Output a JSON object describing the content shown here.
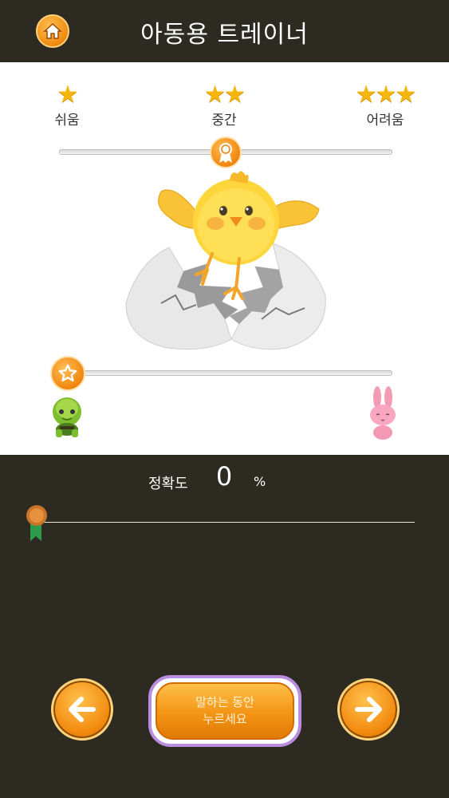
{
  "header": {
    "title": "아동용 트레이너",
    "home_icon": "home-icon"
  },
  "difficulty": {
    "levels": [
      {
        "label": "쉬움",
        "stars": "★"
      },
      {
        "label": "중간",
        "stars": "★★"
      },
      {
        "label": "어려움",
        "stars": "★★★"
      }
    ],
    "selected": "중간",
    "slider_value": 0.5
  },
  "speed": {
    "slow_icon": "turtle-icon",
    "fast_icon": "rabbit-icon",
    "slider_value": 0.0
  },
  "accuracy": {
    "label": "정확도",
    "value": "0",
    "unit": "%"
  },
  "controls": {
    "speak_line1": "말하는 동안",
    "speak_line2": "누르세요"
  },
  "colors": {
    "background": "#2d2b21",
    "accent": "#f28a0f",
    "star": "#f5b70f",
    "speak_border": "#b98de0"
  }
}
